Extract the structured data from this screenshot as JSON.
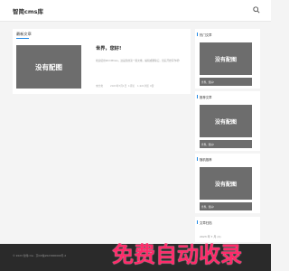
{
  "header": {
    "logo": "智简cms库",
    "search_icon": "search-icon"
  },
  "main": {
    "section_title": "最新文章",
    "post": {
      "thumb_text": "没有配图",
      "title": "世界，您好!",
      "excerpt": "欢迎使用WordPress。这是您的第一篇文章。编辑或删除它，然后开始写作吧!",
      "author": "未分类",
      "date": "2023年7月1日",
      "comments": "1评论",
      "views": "1,921浏览",
      "likes": "0赞"
    }
  },
  "sidebar": {
    "hot": {
      "title": "热门文章",
      "thumb_text": "没有配图",
      "caption": "世界，您好!"
    },
    "recommend": {
      "title": "推荐文章",
      "thumb_text": "没有配图",
      "caption": "世界，您好!"
    },
    "random": {
      "title": "随机推荐",
      "thumb_text": "没有配图",
      "caption": "世界，您好!"
    },
    "archive": {
      "title": "文章归档",
      "date": "2023 年 7 月 (1)"
    }
  },
  "footer": {
    "text": "© 2023 智简cms · 京ICP备2023000000号-2"
  },
  "watermark": "免费自动收录",
  "colors": {
    "accent": "#1e88e5",
    "thumb_bg": "#6d6d6d",
    "watermark": "#ff2a6a",
    "footer_bg": "#2a2a2a"
  }
}
